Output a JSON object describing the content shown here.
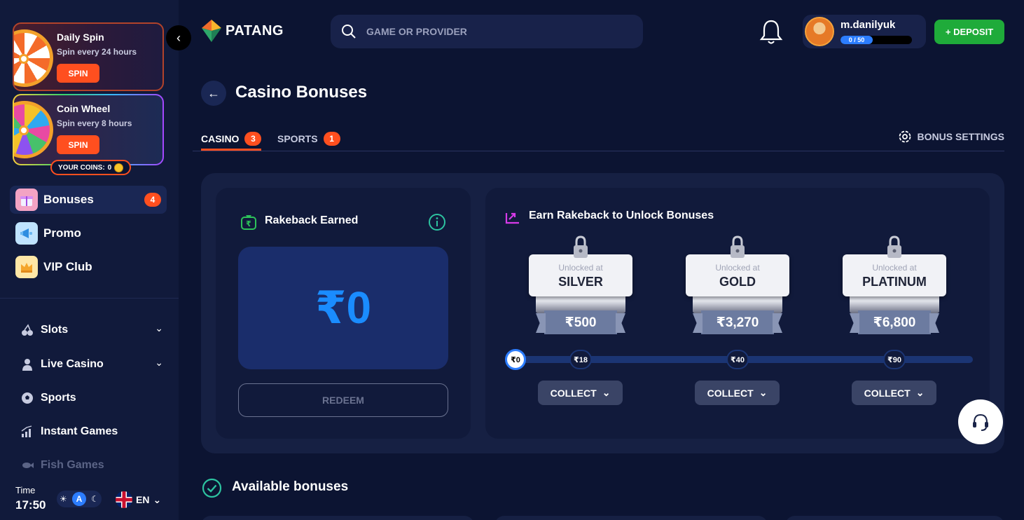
{
  "sidebar": {
    "daily_spin": {
      "title": "Daily Spin",
      "subtitle": "Spin every 24 hours",
      "button": "SPIN"
    },
    "coin_wheel": {
      "title": "Coin Wheel",
      "subtitle": "Spin every 8 hours",
      "button": "SPIN"
    },
    "coins": {
      "label": "YOUR COINS:",
      "value": "0"
    },
    "collapse_glyph": "‹",
    "nav": [
      {
        "label": "Bonuses",
        "badge": "4",
        "icon": "gift-icon"
      },
      {
        "label": "Promo",
        "icon": "megaphone-icon"
      },
      {
        "label": "VIP Club",
        "icon": "crown-icon"
      }
    ],
    "categories": [
      {
        "label": "Slots",
        "icon": "cherry-icon",
        "chevron": "⌄"
      },
      {
        "label": "Live Casino",
        "icon": "dealer-icon",
        "chevron": "⌄"
      },
      {
        "label": "Sports",
        "icon": "football-icon"
      },
      {
        "label": "Instant Games",
        "icon": "chart-bars-icon"
      },
      {
        "label": "Fish Games",
        "icon": "fish-icon"
      }
    ],
    "time": {
      "label": "Time",
      "value": "17:50"
    },
    "theme": {
      "auto_label": "A"
    },
    "language": {
      "code": "EN"
    }
  },
  "header": {
    "logo_text": "PATANG",
    "search": {
      "placeholder": "GAME OR PROVIDER"
    },
    "user": {
      "name": "m.danilyuk",
      "xp": "0 / 50"
    },
    "deposit_label": "+ DEPOSIT"
  },
  "page": {
    "back_glyph": "←",
    "title": "Casino Bonuses",
    "tabs": [
      {
        "label": "CASINO",
        "badge": "3",
        "active": true
      },
      {
        "label": "SPORTS",
        "badge": "1",
        "active": false
      }
    ],
    "bonus_settings_label": "BONUS SETTINGS"
  },
  "rakeback": {
    "title": "Rakeback Earned",
    "amount": "₹0",
    "redeem_label": "REDEEM"
  },
  "unlock": {
    "title": "Earn Rakeback to Unlock Bonuses",
    "tiers": [
      {
        "unlocked_at": "Unlocked at",
        "name": "SILVER",
        "amount": "₹500",
        "collect": "COLLECT"
      },
      {
        "unlocked_at": "Unlocked at",
        "name": "GOLD",
        "amount": "₹3,270",
        "collect": "COLLECT"
      },
      {
        "unlocked_at": "Unlocked at",
        "name": "PLATINUM",
        "amount": "₹6,800",
        "collect": "COLLECT"
      }
    ],
    "track": {
      "start": "₹0",
      "nodes": [
        "₹18",
        "₹40",
        "₹90"
      ]
    }
  },
  "available": {
    "title": "Available bonuses"
  },
  "colors": {
    "accent_orange": "#ff4f1f",
    "accent_blue": "#2c7dff",
    "deposit_green": "#1fab3a",
    "background": "#0c1432"
  }
}
